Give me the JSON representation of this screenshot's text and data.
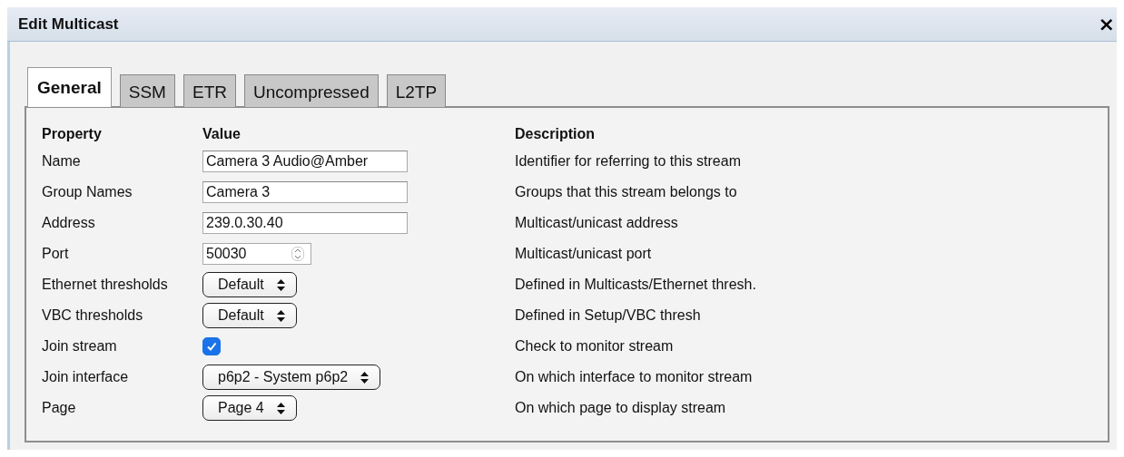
{
  "window": {
    "title": "Edit Multicast",
    "close": "×"
  },
  "tabs": [
    {
      "label": "General",
      "selected": true
    },
    {
      "label": "SSM",
      "selected": false
    },
    {
      "label": "ETR",
      "selected": false
    },
    {
      "label": "Uncompressed",
      "selected": false
    },
    {
      "label": "L2TP",
      "selected": false
    }
  ],
  "table": {
    "columns": [
      "Property",
      "Value",
      "Description"
    ],
    "rows": [
      {
        "property": "Name",
        "kind": "text",
        "value": "Camera 3 Audio@Amber",
        "description": "Identifier for referring to this stream"
      },
      {
        "property": "Group Names",
        "kind": "text",
        "value": "Camera 3",
        "description": "Groups that this stream belongs to"
      },
      {
        "property": "Address",
        "kind": "text",
        "value": "239.0.30.40",
        "description": "Multicast/unicast address"
      },
      {
        "property": "Port",
        "kind": "number",
        "value": "50030",
        "description": "Multicast/unicast port"
      },
      {
        "property": "Ethernet thresholds",
        "kind": "select",
        "value": "Default",
        "description": "Defined in Multicasts/Ethernet thresh."
      },
      {
        "property": "VBC thresholds",
        "kind": "select",
        "value": "Default",
        "description": "Defined in Setup/VBC thresh"
      },
      {
        "property": "Join stream",
        "kind": "checkbox",
        "checked": true,
        "description": "Check to monitor stream"
      },
      {
        "property": "Join interface",
        "kind": "select",
        "value": "p6p2 - System p6p2",
        "description": "On which interface to monitor stream"
      },
      {
        "property": "Page",
        "kind": "select",
        "value": "Page 4",
        "description": "On which page to display stream"
      }
    ]
  }
}
